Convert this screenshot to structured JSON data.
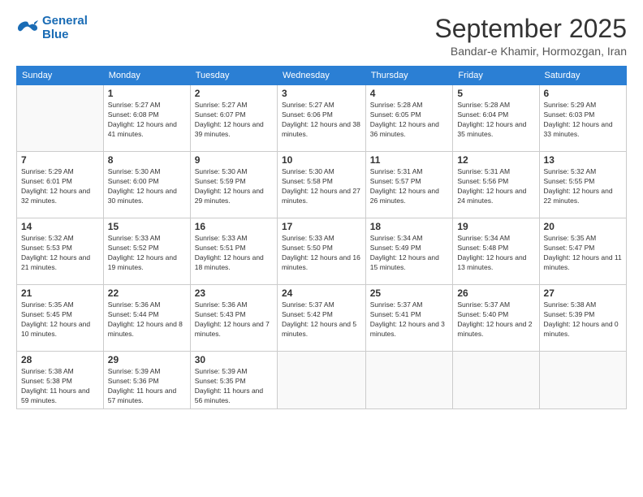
{
  "logo": {
    "line1": "General",
    "line2": "Blue"
  },
  "title": "September 2025",
  "location": "Bandar-e Khamir, Hormozgan, Iran",
  "days_of_week": [
    "Sunday",
    "Monday",
    "Tuesday",
    "Wednesday",
    "Thursday",
    "Friday",
    "Saturday"
  ],
  "weeks": [
    [
      {
        "day": "",
        "sunrise": "",
        "sunset": "",
        "daylight": ""
      },
      {
        "day": "1",
        "sunrise": "Sunrise: 5:27 AM",
        "sunset": "Sunset: 6:08 PM",
        "daylight": "Daylight: 12 hours and 41 minutes."
      },
      {
        "day": "2",
        "sunrise": "Sunrise: 5:27 AM",
        "sunset": "Sunset: 6:07 PM",
        "daylight": "Daylight: 12 hours and 39 minutes."
      },
      {
        "day": "3",
        "sunrise": "Sunrise: 5:27 AM",
        "sunset": "Sunset: 6:06 PM",
        "daylight": "Daylight: 12 hours and 38 minutes."
      },
      {
        "day": "4",
        "sunrise": "Sunrise: 5:28 AM",
        "sunset": "Sunset: 6:05 PM",
        "daylight": "Daylight: 12 hours and 36 minutes."
      },
      {
        "day": "5",
        "sunrise": "Sunrise: 5:28 AM",
        "sunset": "Sunset: 6:04 PM",
        "daylight": "Daylight: 12 hours and 35 minutes."
      },
      {
        "day": "6",
        "sunrise": "Sunrise: 5:29 AM",
        "sunset": "Sunset: 6:03 PM",
        "daylight": "Daylight: 12 hours and 33 minutes."
      }
    ],
    [
      {
        "day": "7",
        "sunrise": "Sunrise: 5:29 AM",
        "sunset": "Sunset: 6:01 PM",
        "daylight": "Daylight: 12 hours and 32 minutes."
      },
      {
        "day": "8",
        "sunrise": "Sunrise: 5:30 AM",
        "sunset": "Sunset: 6:00 PM",
        "daylight": "Daylight: 12 hours and 30 minutes."
      },
      {
        "day": "9",
        "sunrise": "Sunrise: 5:30 AM",
        "sunset": "Sunset: 5:59 PM",
        "daylight": "Daylight: 12 hours and 29 minutes."
      },
      {
        "day": "10",
        "sunrise": "Sunrise: 5:30 AM",
        "sunset": "Sunset: 5:58 PM",
        "daylight": "Daylight: 12 hours and 27 minutes."
      },
      {
        "day": "11",
        "sunrise": "Sunrise: 5:31 AM",
        "sunset": "Sunset: 5:57 PM",
        "daylight": "Daylight: 12 hours and 26 minutes."
      },
      {
        "day": "12",
        "sunrise": "Sunrise: 5:31 AM",
        "sunset": "Sunset: 5:56 PM",
        "daylight": "Daylight: 12 hours and 24 minutes."
      },
      {
        "day": "13",
        "sunrise": "Sunrise: 5:32 AM",
        "sunset": "Sunset: 5:55 PM",
        "daylight": "Daylight: 12 hours and 22 minutes."
      }
    ],
    [
      {
        "day": "14",
        "sunrise": "Sunrise: 5:32 AM",
        "sunset": "Sunset: 5:53 PM",
        "daylight": "Daylight: 12 hours and 21 minutes."
      },
      {
        "day": "15",
        "sunrise": "Sunrise: 5:33 AM",
        "sunset": "Sunset: 5:52 PM",
        "daylight": "Daylight: 12 hours and 19 minutes."
      },
      {
        "day": "16",
        "sunrise": "Sunrise: 5:33 AM",
        "sunset": "Sunset: 5:51 PM",
        "daylight": "Daylight: 12 hours and 18 minutes."
      },
      {
        "day": "17",
        "sunrise": "Sunrise: 5:33 AM",
        "sunset": "Sunset: 5:50 PM",
        "daylight": "Daylight: 12 hours and 16 minutes."
      },
      {
        "day": "18",
        "sunrise": "Sunrise: 5:34 AM",
        "sunset": "Sunset: 5:49 PM",
        "daylight": "Daylight: 12 hours and 15 minutes."
      },
      {
        "day": "19",
        "sunrise": "Sunrise: 5:34 AM",
        "sunset": "Sunset: 5:48 PM",
        "daylight": "Daylight: 12 hours and 13 minutes."
      },
      {
        "day": "20",
        "sunrise": "Sunrise: 5:35 AM",
        "sunset": "Sunset: 5:47 PM",
        "daylight": "Daylight: 12 hours and 11 minutes."
      }
    ],
    [
      {
        "day": "21",
        "sunrise": "Sunrise: 5:35 AM",
        "sunset": "Sunset: 5:45 PM",
        "daylight": "Daylight: 12 hours and 10 minutes."
      },
      {
        "day": "22",
        "sunrise": "Sunrise: 5:36 AM",
        "sunset": "Sunset: 5:44 PM",
        "daylight": "Daylight: 12 hours and 8 minutes."
      },
      {
        "day": "23",
        "sunrise": "Sunrise: 5:36 AM",
        "sunset": "Sunset: 5:43 PM",
        "daylight": "Daylight: 12 hours and 7 minutes."
      },
      {
        "day": "24",
        "sunrise": "Sunrise: 5:37 AM",
        "sunset": "Sunset: 5:42 PM",
        "daylight": "Daylight: 12 hours and 5 minutes."
      },
      {
        "day": "25",
        "sunrise": "Sunrise: 5:37 AM",
        "sunset": "Sunset: 5:41 PM",
        "daylight": "Daylight: 12 hours and 3 minutes."
      },
      {
        "day": "26",
        "sunrise": "Sunrise: 5:37 AM",
        "sunset": "Sunset: 5:40 PM",
        "daylight": "Daylight: 12 hours and 2 minutes."
      },
      {
        "day": "27",
        "sunrise": "Sunrise: 5:38 AM",
        "sunset": "Sunset: 5:39 PM",
        "daylight": "Daylight: 12 hours and 0 minutes."
      }
    ],
    [
      {
        "day": "28",
        "sunrise": "Sunrise: 5:38 AM",
        "sunset": "Sunset: 5:38 PM",
        "daylight": "Daylight: 11 hours and 59 minutes."
      },
      {
        "day": "29",
        "sunrise": "Sunrise: 5:39 AM",
        "sunset": "Sunset: 5:36 PM",
        "daylight": "Daylight: 11 hours and 57 minutes."
      },
      {
        "day": "30",
        "sunrise": "Sunrise: 5:39 AM",
        "sunset": "Sunset: 5:35 PM",
        "daylight": "Daylight: 11 hours and 56 minutes."
      },
      {
        "day": "",
        "sunrise": "",
        "sunset": "",
        "daylight": ""
      },
      {
        "day": "",
        "sunrise": "",
        "sunset": "",
        "daylight": ""
      },
      {
        "day": "",
        "sunrise": "",
        "sunset": "",
        "daylight": ""
      },
      {
        "day": "",
        "sunrise": "",
        "sunset": "",
        "daylight": ""
      }
    ]
  ]
}
